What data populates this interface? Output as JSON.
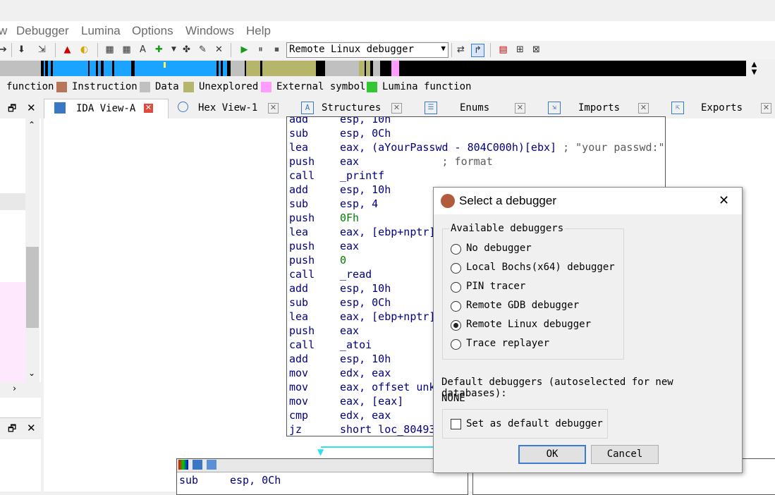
{
  "menu": [
    "w",
    "Debugger",
    "Lumina",
    "Options",
    "Windows",
    "Help"
  ],
  "toolbar": {
    "debugger_select": "Remote Linux debugger"
  },
  "legend": [
    {
      "label": "function",
      "color": ""
    },
    {
      "label": "Instruction",
      "color": "#b8755a"
    },
    {
      "label": "Data",
      "color": "#c0c0c0"
    },
    {
      "label": "Unexplored",
      "color": "#b5b56b"
    },
    {
      "label": "External symbol",
      "color": "#ff9cff"
    },
    {
      "label": "Lumina function",
      "color": "#34c734"
    }
  ],
  "tabs": [
    "IDA View-A",
    "Hex View-1",
    "Structures",
    "Enums",
    "Imports",
    "Exports"
  ],
  "disasm": [
    {
      "mn": "add",
      "op": "esp, 10h",
      "cm": ""
    },
    {
      "mn": "sub",
      "op": "esp, 0Ch",
      "cm": ""
    },
    {
      "mn": "lea",
      "op": "eax, (aYourPasswd - 804C000h)[ebx]",
      "cm": " ; \"your passwd:\""
    },
    {
      "mn": "push",
      "op": "eax",
      "cm": "             ; format"
    },
    {
      "mn": "call",
      "op": "_printf",
      "cm": ""
    },
    {
      "mn": "add",
      "op": "esp, 10h",
      "cm": ""
    },
    {
      "mn": "sub",
      "op": "esp, 4",
      "cm": ""
    },
    {
      "mn": "push",
      "op": "0Fh",
      "cm": ""
    },
    {
      "mn": "lea",
      "op": "eax, [ebp+nptr]",
      "cm": ""
    },
    {
      "mn": "push",
      "op": "eax",
      "cm": ""
    },
    {
      "mn": "push",
      "op": "0",
      "cm": ""
    },
    {
      "mn": "call",
      "op": "_read",
      "cm": ""
    },
    {
      "mn": "add",
      "op": "esp, 10h",
      "cm": ""
    },
    {
      "mn": "sub",
      "op": "esp, 0Ch",
      "cm": ""
    },
    {
      "mn": "lea",
      "op": "eax, [ebp+nptr]",
      "cm": ""
    },
    {
      "mn": "push",
      "op": "eax",
      "cm": ""
    },
    {
      "mn": "call",
      "op": "_atoi",
      "cm": ""
    },
    {
      "mn": "add",
      "op": "esp, 10h",
      "cm": ""
    },
    {
      "mn": "mov",
      "op": "edx, eax",
      "cm": ""
    },
    {
      "mn": "mov",
      "op": "eax, offset unk",
      "cm": ""
    },
    {
      "mn": "mov",
      "op": "eax, [eax]",
      "cm": ""
    },
    {
      "mn": "cmp",
      "op": "edx, eax",
      "cm": ""
    },
    {
      "mn": "jz",
      "op": "short loc_80493",
      "cm": ""
    }
  ],
  "lower_block": [
    {
      "mn": "sub",
      "op": "esp, 0Ch"
    }
  ],
  "dialog": {
    "title": "Select a debugger",
    "group_label": "Available debuggers",
    "options": [
      {
        "label": "No debugger",
        "selected": false
      },
      {
        "label": "Local Bochs(x64) debugger",
        "selected": false
      },
      {
        "label": "PIN tracer",
        "selected": false
      },
      {
        "label": "Remote GDB debugger",
        "selected": false
      },
      {
        "label": "Remote Linux debugger",
        "selected": true
      },
      {
        "label": "Trace replayer",
        "selected": false
      }
    ],
    "default_label": "Default debuggers (autoselected for new databases):",
    "default_value": "NONE",
    "checkbox_label": "Set as default debugger",
    "checkbox_checked": false,
    "ok": "OK",
    "cancel": "Cancel"
  }
}
